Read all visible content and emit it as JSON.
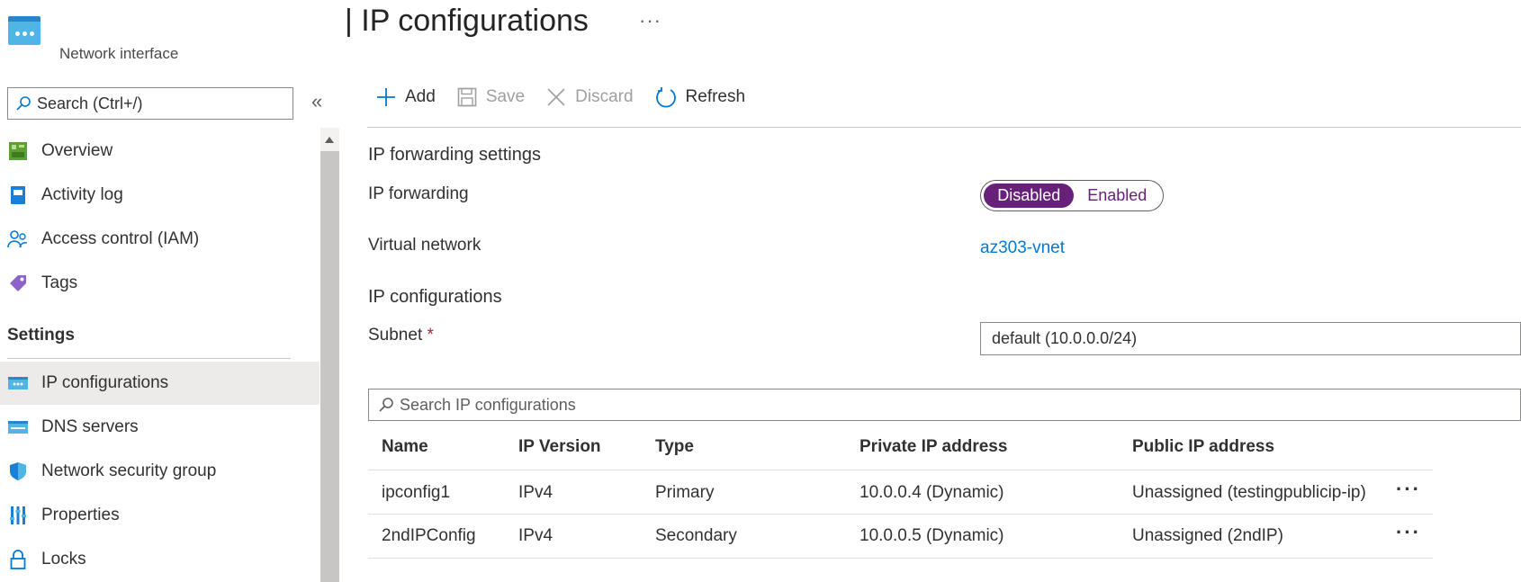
{
  "header": {
    "resource_type": "Network interface",
    "page_title": "| IP configurations",
    "more": "···"
  },
  "sidebar": {
    "search_placeholder": "Search (Ctrl+/)",
    "collapse": "«",
    "items": [
      {
        "label": "Overview",
        "icon": "overview-icon"
      },
      {
        "label": "Activity log",
        "icon": "activity-log-icon"
      },
      {
        "label": "Access control (IAM)",
        "icon": "iam-icon"
      },
      {
        "label": "Tags",
        "icon": "tag-icon"
      }
    ],
    "section_title": "Settings",
    "settings_items": [
      {
        "label": "IP configurations",
        "icon": "ip-config-icon",
        "selected": true
      },
      {
        "label": "DNS servers",
        "icon": "dns-icon"
      },
      {
        "label": "Network security group",
        "icon": "shield-icon"
      },
      {
        "label": "Properties",
        "icon": "properties-icon"
      },
      {
        "label": "Locks",
        "icon": "lock-icon"
      }
    ]
  },
  "toolbar": {
    "add": "Add",
    "save": "Save",
    "discard": "Discard",
    "refresh": "Refresh"
  },
  "form": {
    "forwarding_section": "IP forwarding settings",
    "ip_forwarding_label": "IP forwarding",
    "toggle_disabled": "Disabled",
    "toggle_enabled": "Enabled",
    "toggle_selected": "Disabled",
    "vnet_label": "Virtual network",
    "vnet_value": "az303-vnet",
    "ipconfig_section": "IP configurations",
    "subnet_label": "Subnet",
    "subnet_required": "*",
    "subnet_value": "default (10.0.0.0/24)",
    "grid_search_placeholder": "Search IP configurations"
  },
  "table": {
    "columns": [
      "Name",
      "IP Version",
      "Type",
      "Private IP address",
      "Public IP address"
    ],
    "rows": [
      [
        "ipconfig1",
        "IPv4",
        "Primary",
        "10.0.0.4 (Dynamic)",
        "Unassigned (testingpublicip-ip)"
      ],
      [
        "2ndIPConfig",
        "IPv4",
        "Secondary",
        "10.0.0.5 (Dynamic)",
        "Unassigned (2ndIP)"
      ]
    ],
    "row_more": "···"
  },
  "colors": {
    "accent": "#0078d4",
    "toggle": "#68217a",
    "selected_nav": "#edebe9"
  }
}
